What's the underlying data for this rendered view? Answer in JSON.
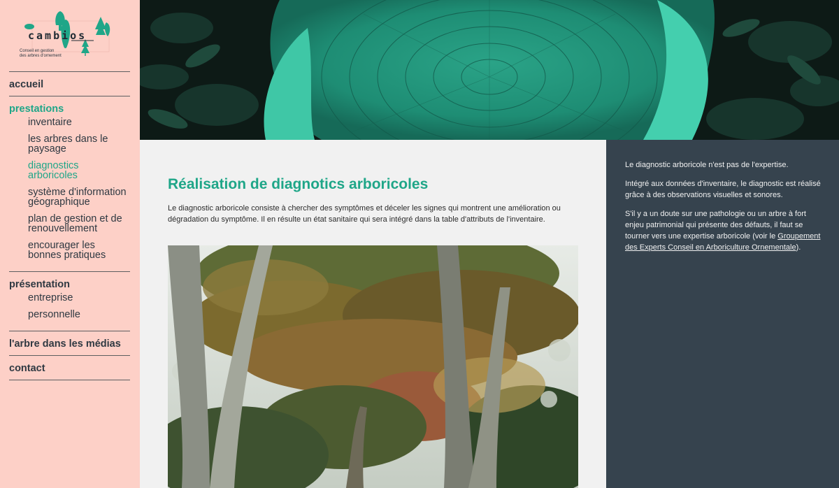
{
  "logo": {
    "name": "cambios",
    "tagline_line1": "Conseil en gestion",
    "tagline_line2": "des arbres d'ornement"
  },
  "colors": {
    "sidebar_bg": "#fdd0c7",
    "accent": "#1fa688",
    "aside_bg": "#36434e",
    "content_bg": "#f1f1f1"
  },
  "nav": {
    "accueil": "accueil",
    "prestations": "prestations",
    "prestations_items": [
      "inventaire",
      "les arbres dans le paysage",
      "diagnostics arboricoles",
      "système d'information géographique",
      "plan de gestion et de renouvellement",
      "encourager les bonnes pratiques"
    ],
    "presentation": "présentation",
    "presentation_items": [
      "entreprise",
      "personnelle"
    ],
    "medias": "l'arbre dans les médias",
    "contact": "contact"
  },
  "main": {
    "title": "Réalisation de diagnotics arboricoles",
    "intro": "Le diagnostic arboricole consiste à chercher des symptômes et déceler les signes qui montrent une amélioration ou dégradation du symptôme. Il en résulte un état sanitaire qui sera intégré dans la table d'attributs de l'inventaire."
  },
  "aside": {
    "p1": "Le diagnostic arboricole n'est pas de l'expertise.",
    "p2": "Intégré aux données d'inventaire, le diagnostic est réalisé grâce à des observations visuelles et sonores.",
    "p3_before": "S'il y a un doute sur une pathologie ou un arbre à fort enjeu patrimonial qui présente des défauts, il faut se tourner vers une expertise arboricole (voir le ",
    "p3_link": "Groupement des Experts Conseil en Arboriculture Ornementale",
    "p3_after": ")."
  }
}
